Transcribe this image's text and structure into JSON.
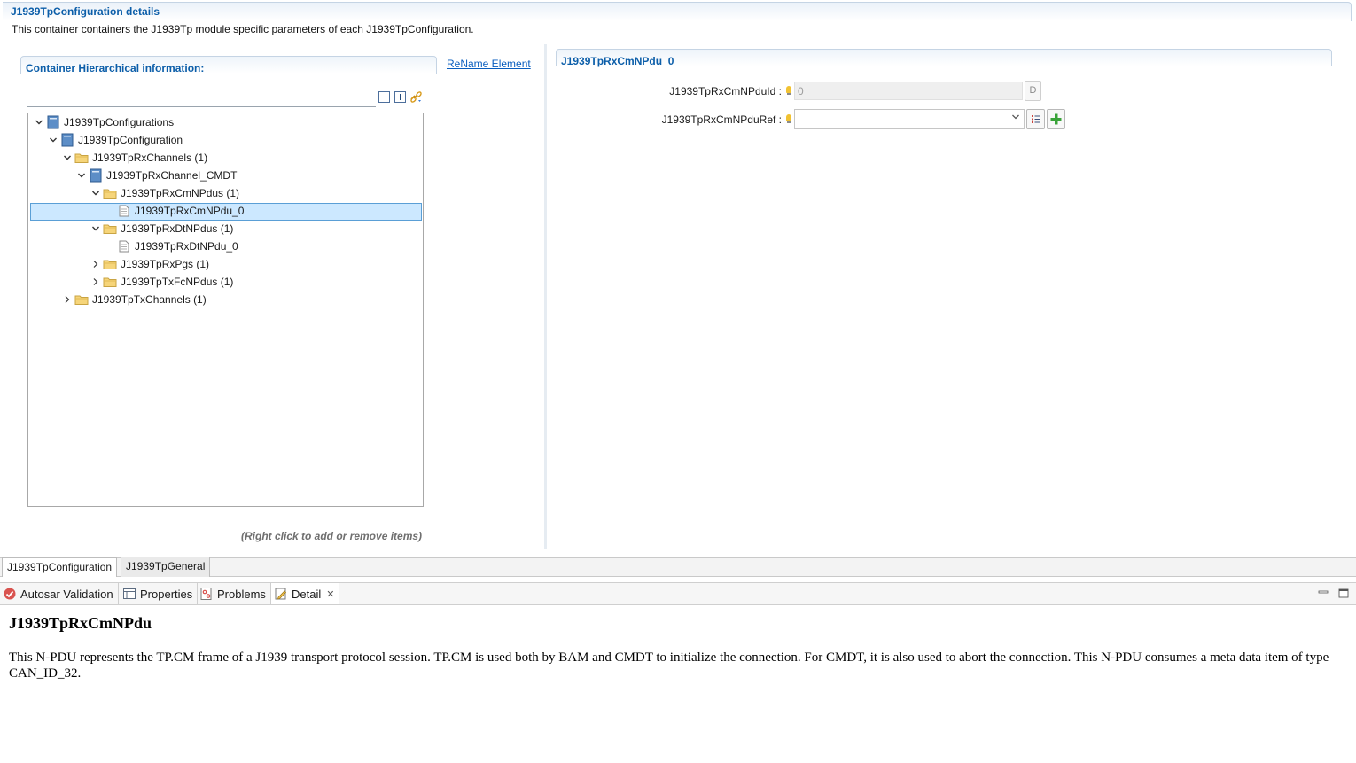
{
  "header": {
    "title": "J1939TpConfiguration details",
    "description": "This container containers the J1939Tp module specific parameters of each J1939TpConfiguration."
  },
  "left_panel": {
    "title": "Container Hierarchical information:",
    "rename_link": "ReName Element",
    "filter_value": "",
    "hint": "(Right click to add or remove items)",
    "tree": [
      {
        "label": "J1939TpConfigurations",
        "expanded": true,
        "icon": "module-icon"
      },
      {
        "label": "J1939TpConfiguration",
        "expanded": true,
        "icon": "container-icon"
      },
      {
        "label": "J1939TpRxChannels (1)",
        "expanded": true,
        "icon": "folder-icon"
      },
      {
        "label": "J1939TpRxChannel_CMDT",
        "expanded": true,
        "icon": "container-icon"
      },
      {
        "label": "J1939TpRxCmNPdus (1)",
        "expanded": true,
        "icon": "folder-icon"
      },
      {
        "label": "J1939TpRxCmNPdu_0",
        "selected": true,
        "icon": "document-icon"
      },
      {
        "label": "J1939TpRxDtNPdus (1)",
        "expanded": true,
        "icon": "folder-icon"
      },
      {
        "label": "J1939TpRxDtNPdu_0",
        "icon": "document-icon"
      },
      {
        "label": "J1939TpRxPgs (1)",
        "expanded": false,
        "icon": "folder-icon"
      },
      {
        "label": "J1939TpTxFcNPdus (1)",
        "expanded": false,
        "icon": "folder-icon"
      },
      {
        "label": "J1939TpTxChannels (1)",
        "expanded": false,
        "icon": "folder-icon"
      }
    ]
  },
  "right_panel": {
    "title": "J1939TpRxCmNPdu_0",
    "fields": [
      {
        "label": "J1939TpRxCmNPduId :",
        "value": "0",
        "button": "D"
      },
      {
        "label": "J1939TpRxCmNPduRef :",
        "value": ""
      }
    ]
  },
  "editor_tabs": [
    "J1939TpConfiguration",
    "J1939TpGeneral"
  ],
  "view_tabs": [
    "Autosar Validation",
    "Properties",
    "Problems",
    "Detail"
  ],
  "detail": {
    "title": "J1939TpRxCmNPdu",
    "body": "This N-PDU represents the TP.CM frame of a J1939 transport protocol session. TP.CM is used both by BAM and CMDT to initialize the connection. For CMDT, it is also used to abort the connection. This N-PDU consumes a meta data item of type CAN_ID_32."
  },
  "colors": {
    "accent": "#0c5ea9",
    "selection": "#cce8ff",
    "folder": "#f6d57a"
  }
}
